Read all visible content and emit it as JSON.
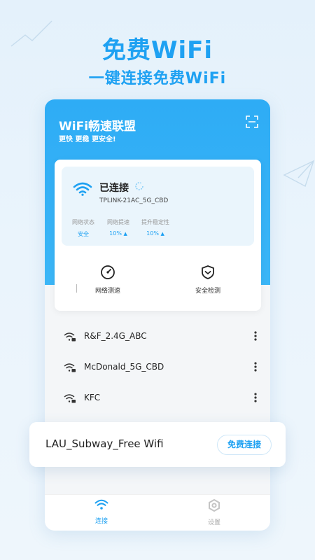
{
  "promo": {
    "title": "免费WiFi",
    "subtitle": "一键连接免费WiFi"
  },
  "app": {
    "title": "WiFi畅速联盟",
    "slogan": "更快 更稳 更安全!",
    "scan_icon": "scan-icon"
  },
  "connection": {
    "status": "已连接",
    "ssid": "TPLINK-21AC_5G_CBD",
    "stats": [
      {
        "label": "网络状态",
        "value": "安全"
      },
      {
        "label": "网络提速",
        "value": "10%"
      },
      {
        "label": "提升稳定性",
        "value": "10%"
      }
    ],
    "up_arrow": "▲"
  },
  "tools": [
    {
      "label": "网络测速",
      "icon": "speedometer-icon"
    },
    {
      "label": "安全检测",
      "icon": "shield-icon"
    }
  ],
  "wifi_list": [
    {
      "name": "R&F_2.4G_ABC"
    },
    {
      "name": "McDonald_5G_CBD"
    },
    {
      "name": "KFC"
    }
  ],
  "popup": {
    "name": "LAU_Subway_Free Wifi",
    "button": "免费连接"
  },
  "tabs": [
    {
      "label": "连接",
      "active": true
    },
    {
      "label": "设置",
      "active": false
    }
  ],
  "colors": {
    "accent": "#1ea1f2",
    "header": "#2eacf5",
    "background": "#e4f1fb"
  }
}
